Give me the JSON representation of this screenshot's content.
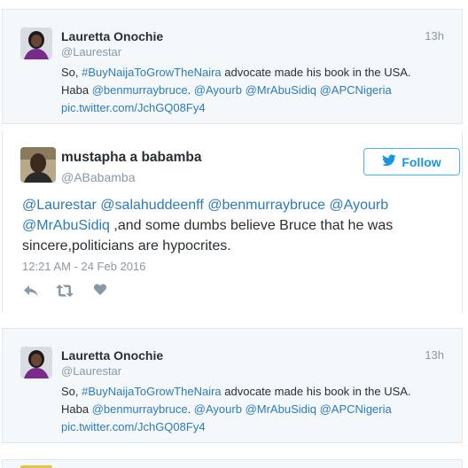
{
  "tweet1": {
    "name": "Lauretta Onochie",
    "handle": "@Laurestar",
    "time": "13h",
    "line1": {
      "pre": "So, ",
      "hashtag": "#BuyNaijaToGrowTheNaira",
      "post": " advocate made his book in the USA."
    },
    "line2": {
      "pre": "Haba ",
      "m1": "@benmurraybruce",
      "sep": ". ",
      "m2": "@Ayourb",
      "m3": "@MrAbuSidiq",
      "m4": "@APCNigeria"
    },
    "link": "pic.twitter.com/JchGQ08Fy4"
  },
  "main": {
    "name": "mustapha a babamba",
    "handle": "@ABabamba",
    "follow_label": "Follow",
    "line1": {
      "m1": "@Laurestar",
      "m2": "@salahuddeenff",
      "m3": "@benmurraybruce",
      "m4": "@Ayourb"
    },
    "line2": {
      "m1": "@MrAbuSidiq",
      "text": " ,and some dumbs believe Bruce that he was"
    },
    "line3": "sincere,politicians are hypocrites.",
    "date": "12:21 AM - 24 Feb 2016"
  },
  "tweet2": {
    "name": "Lauretta Onochie",
    "handle": "@Laurestar",
    "time": "13h",
    "line1": {
      "pre": "So, ",
      "hashtag": "#BuyNaijaToGrowTheNaira",
      "post": " advocate made his book in the USA."
    },
    "line2": {
      "pre": "Haba ",
      "m1": "@benmurraybruce",
      "sep": ". ",
      "m2": "@Ayourb",
      "m3": "@MrAbuSidiq",
      "m4": "@APCNigeria"
    },
    "link": "pic.twitter.com/JchGQ08Fy4"
  },
  "icons": {
    "reply": "reply-icon",
    "retweet": "retweet-icon",
    "like": "heart-icon",
    "follow": "twitter-bird-icon"
  },
  "colors": {
    "link": "#2b7bb9",
    "muted": "#8899a6",
    "follow_border": "#4ab3f4",
    "card_bg": "#f5f8fa"
  }
}
